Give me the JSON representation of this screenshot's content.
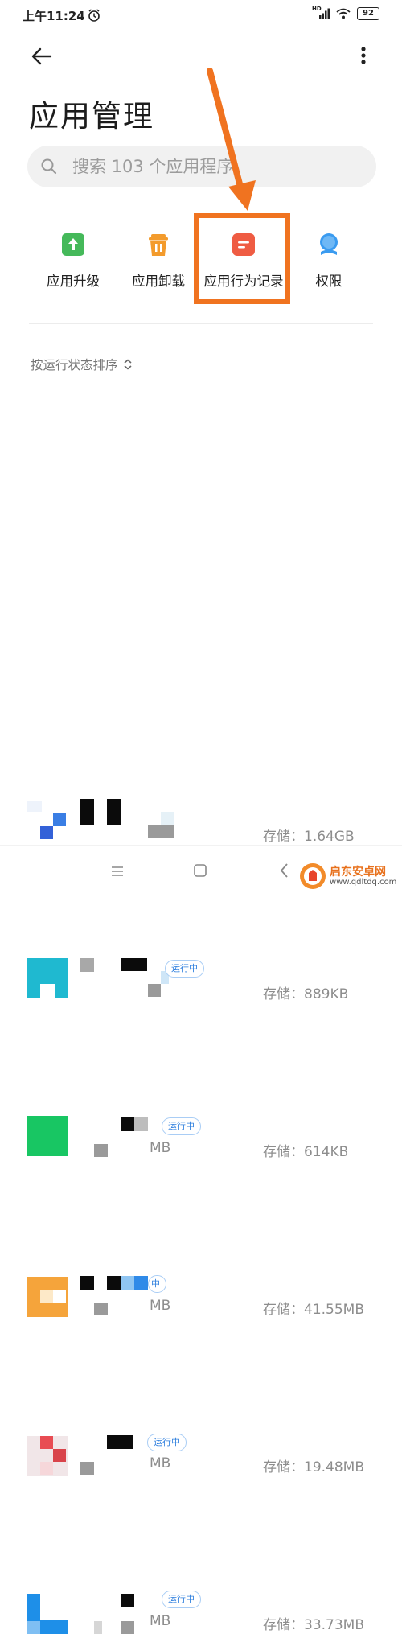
{
  "status_bar": {
    "time": "上午11:24",
    "network_label": "HD",
    "battery": "92",
    "icons": [
      "alarm-icon",
      "signal-icon",
      "wifi-icon",
      "battery-icon"
    ]
  },
  "header": {
    "back_icon": "arrow-left-icon",
    "more_icon": "more-vertical-icon",
    "title": "应用管理"
  },
  "search": {
    "placeholder": "搜索 103 个应用程序"
  },
  "actions": [
    {
      "label": "应用升级",
      "icon": "upgrade-icon",
      "color": "#45b95a"
    },
    {
      "label": "应用卸载",
      "icon": "trash-icon",
      "color": "#f39b2c"
    },
    {
      "label": "应用行为记录",
      "icon": "behavior-record-icon",
      "color": "#ef5c43"
    },
    {
      "label": "权限",
      "icon": "permission-icon",
      "color": "#3a9bf0"
    }
  ],
  "annotation": {
    "highlight_color": "#f07320",
    "arrow_color": "#f07320"
  },
  "sort": {
    "label": "按运行状态排序",
    "icon": "sort-toggle-icon"
  },
  "apps": [
    {
      "storage": "存储：1.64GB",
      "running": null,
      "size_partial": null
    },
    {
      "storage": "存储：889KB",
      "running": "运行中",
      "size_partial": null
    },
    {
      "storage": "存储：614KB",
      "running": "运行中",
      "size_partial": "MB"
    },
    {
      "storage": "存储：41.55MB",
      "running": "中",
      "size_partial": "MB"
    },
    {
      "storage": "存储：19.48MB",
      "running": "运行中",
      "size_partial": "MB"
    },
    {
      "storage": "存储：33.73MB",
      "running": "运行中",
      "size_partial": "MB"
    }
  ],
  "bottom_nav": {
    "icons": [
      "menu-icon",
      "home-icon",
      "back-icon"
    ]
  },
  "watermark": {
    "title": "启东安卓网",
    "url": "www.qdltdq.com"
  }
}
